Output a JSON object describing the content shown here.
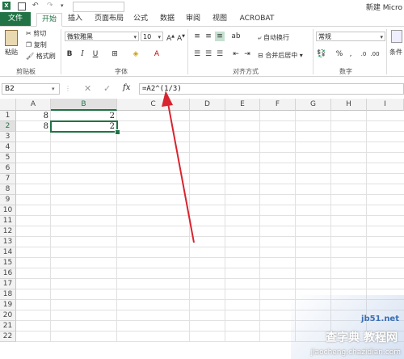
{
  "window": {
    "title": "新建 Micro"
  },
  "tabs": [
    "文件",
    "开始",
    "插入",
    "页面布局",
    "公式",
    "数据",
    "审阅",
    "视图",
    "ACROBAT"
  ],
  "clipboard": {
    "paste": "粘贴",
    "cut": "剪切",
    "copy": "复制",
    "format_painter": "格式刷",
    "label": "剪贴板"
  },
  "font": {
    "name": "微软雅黑",
    "size": "10",
    "label": "字体",
    "bold": "B",
    "italic": "I",
    "underline": "U"
  },
  "alignment": {
    "wrap": "自动换行",
    "merge": "合并后居中",
    "label": "对齐方式"
  },
  "number": {
    "format": "常规",
    "percent": "%",
    "comma": ",",
    "label": "数字"
  },
  "styles": {
    "conditional": "条件"
  },
  "formula_bar": {
    "name_box": "B2",
    "fx": "fx",
    "formula": "=A2^(1/3)"
  },
  "columns": [
    "A",
    "B",
    "C",
    "D",
    "E",
    "F",
    "G",
    "H",
    "I"
  ],
  "rows": [
    "1",
    "2",
    "3",
    "4",
    "5",
    "6",
    "7",
    "8",
    "9",
    "10",
    "11",
    "12",
    "13",
    "14",
    "15",
    "16",
    "17",
    "18",
    "19",
    "20",
    "21",
    "22"
  ],
  "cells": {
    "A1": "8",
    "B1": "2",
    "A2": "8",
    "B2": "2"
  },
  "watermark": {
    "line1": "查字典 教程网",
    "line2": "jiaocheng.chazidian.com",
    "site": "jb51.net"
  },
  "colors": {
    "accent": "#217346",
    "annotation_arrow": "#d9232e"
  }
}
